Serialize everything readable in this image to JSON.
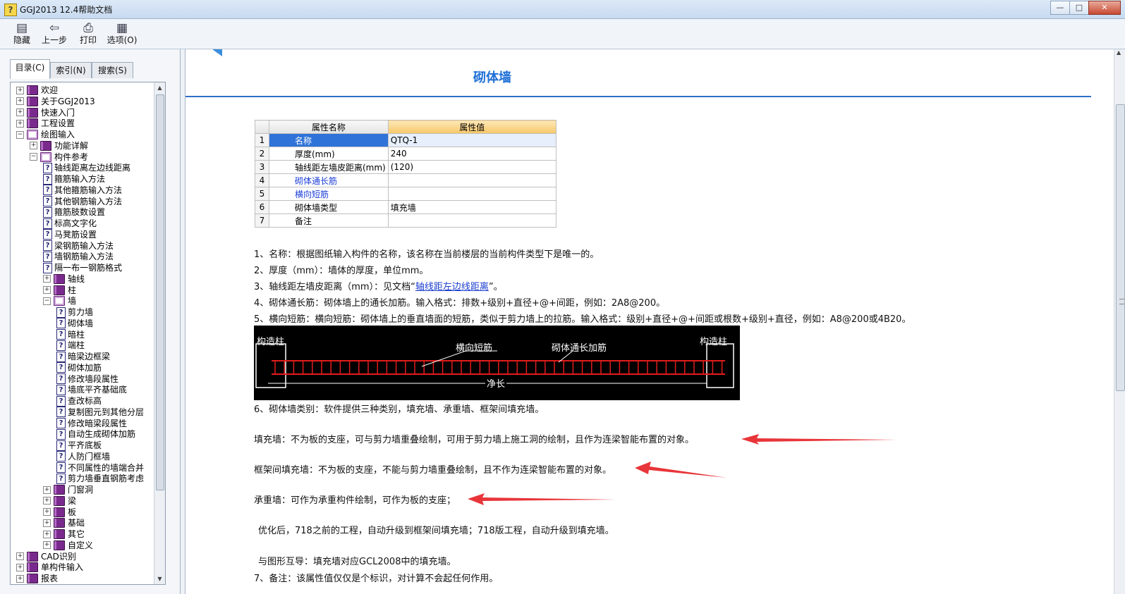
{
  "window": {
    "title": "GGJ2013 12.4帮助文档",
    "min": "—",
    "max": "□",
    "close": "✕"
  },
  "toolbar": {
    "hide": "隐藏",
    "back": "上一步",
    "print": "打印",
    "options": "选项(O)"
  },
  "tabs": {
    "contents": "目录(C)",
    "index": "索引(N)",
    "search": "搜索(S)"
  },
  "tree": [
    "欢迎",
    "关于GGJ2013",
    "快速入门",
    "工程设置",
    "绘图输入",
    "功能详解",
    "构件参考",
    "轴线距离左边线距离",
    "箍筋输入方法",
    "其他箍筋输入方法",
    "其他钢筋输入方法",
    "箍筋肢数设置",
    "标高文字化",
    "马凳筋设置",
    "梁钢筋输入方法",
    "墙钢筋输入方法",
    "隔一布一钢筋格式",
    "轴线",
    "柱",
    "墙",
    "剪力墙",
    "砌体墙",
    "暗柱",
    "端柱",
    "暗梁边框梁",
    "砌体加筋",
    "修改墙段属性",
    "墙底平齐基础底",
    "查改标高",
    "复制图元到其他分层",
    "修改暗梁段属性",
    "自动生成砌体加筋",
    "平齐底板",
    "人防门框墙",
    "不同属性的墙端合并",
    "剪力墙垂直钢筋考虑",
    "门窗洞",
    "梁",
    "板",
    "基础",
    "其它",
    "自定义",
    "CAD识别",
    "单构件输入",
    "报表"
  ],
  "page": {
    "title": "砌体墙",
    "table": {
      "headers": [
        "属性名称",
        "属性值"
      ],
      "rows": [
        [
          "1",
          "名称",
          "QTQ-1"
        ],
        [
          "2",
          "厚度(mm)",
          "240"
        ],
        [
          "3",
          "轴线距左墙皮距离(mm)",
          "(120)"
        ],
        [
          "4",
          "砌体通长筋",
          ""
        ],
        [
          "5",
          "横向短筋",
          ""
        ],
        [
          "6",
          "砌体墙类型",
          "填充墙"
        ],
        [
          "7",
          "备注",
          ""
        ]
      ]
    },
    "item1": "1、名称：根据图纸输入构件的名称，该名称在当前楼层的当前构件类型下是唯一的。",
    "item2": "2、厚度（mm）：墙体的厚度，单位mm。",
    "item3_pre": "3、轴线距左墙皮距离（mm）：见文档“",
    "item3_link": "轴线距左边线距离",
    "item3_post": "”。",
    "item4": "4、砌体通长筋：砌体墙上的通长加筋。输入格式：排数+级别+直径+@+间距，例如：2A8@200。",
    "item5": "5、横向短筋：横向短筋：砌体墙上的垂直墙面的短筋，类似于剪力墙上的拉筋。输入格式：级别+直径+@+间距或根数+级别+直径，例如：A8@200或4B20。",
    "diagram": {
      "left_col": "构造柱",
      "right_col": "构造柱",
      "short_bar": "横向短筋",
      "long_bar": "砌体通长加筋",
      "net_len": "净长"
    },
    "item6": "6、砌体墙类别：软件提供三种类别，填充墙、承重墙、框架间填充墙。",
    "fill_wall": "填充墙：不为板的支座，可与剪力墙重叠绘制，可用于剪力墙上施工洞的绘制，且作为连梁智能布置的对象。",
    "frame_fill": "框架间填充墙：不为板的支座，不能与剪力墙重叠绘制，且不作为连梁智能布置的对象。",
    "bearing": "承重墙：可作为承重构件绘制，可作为板的支座；",
    "optimize": "优化后，718之前的工程，自动升级到框架间填充墙；718版工程，自动升级到填充墙。",
    "interop": "与图形互导：填充墙对应GCL2008中的填充墙。",
    "item7": "7、备注：该属性值仅仅是个标识，对计算不会起任何作用。"
  },
  "colors": {
    "heading": "#1d6fd6",
    "arrow": "#e8353a",
    "selection": "#2f73d8"
  }
}
